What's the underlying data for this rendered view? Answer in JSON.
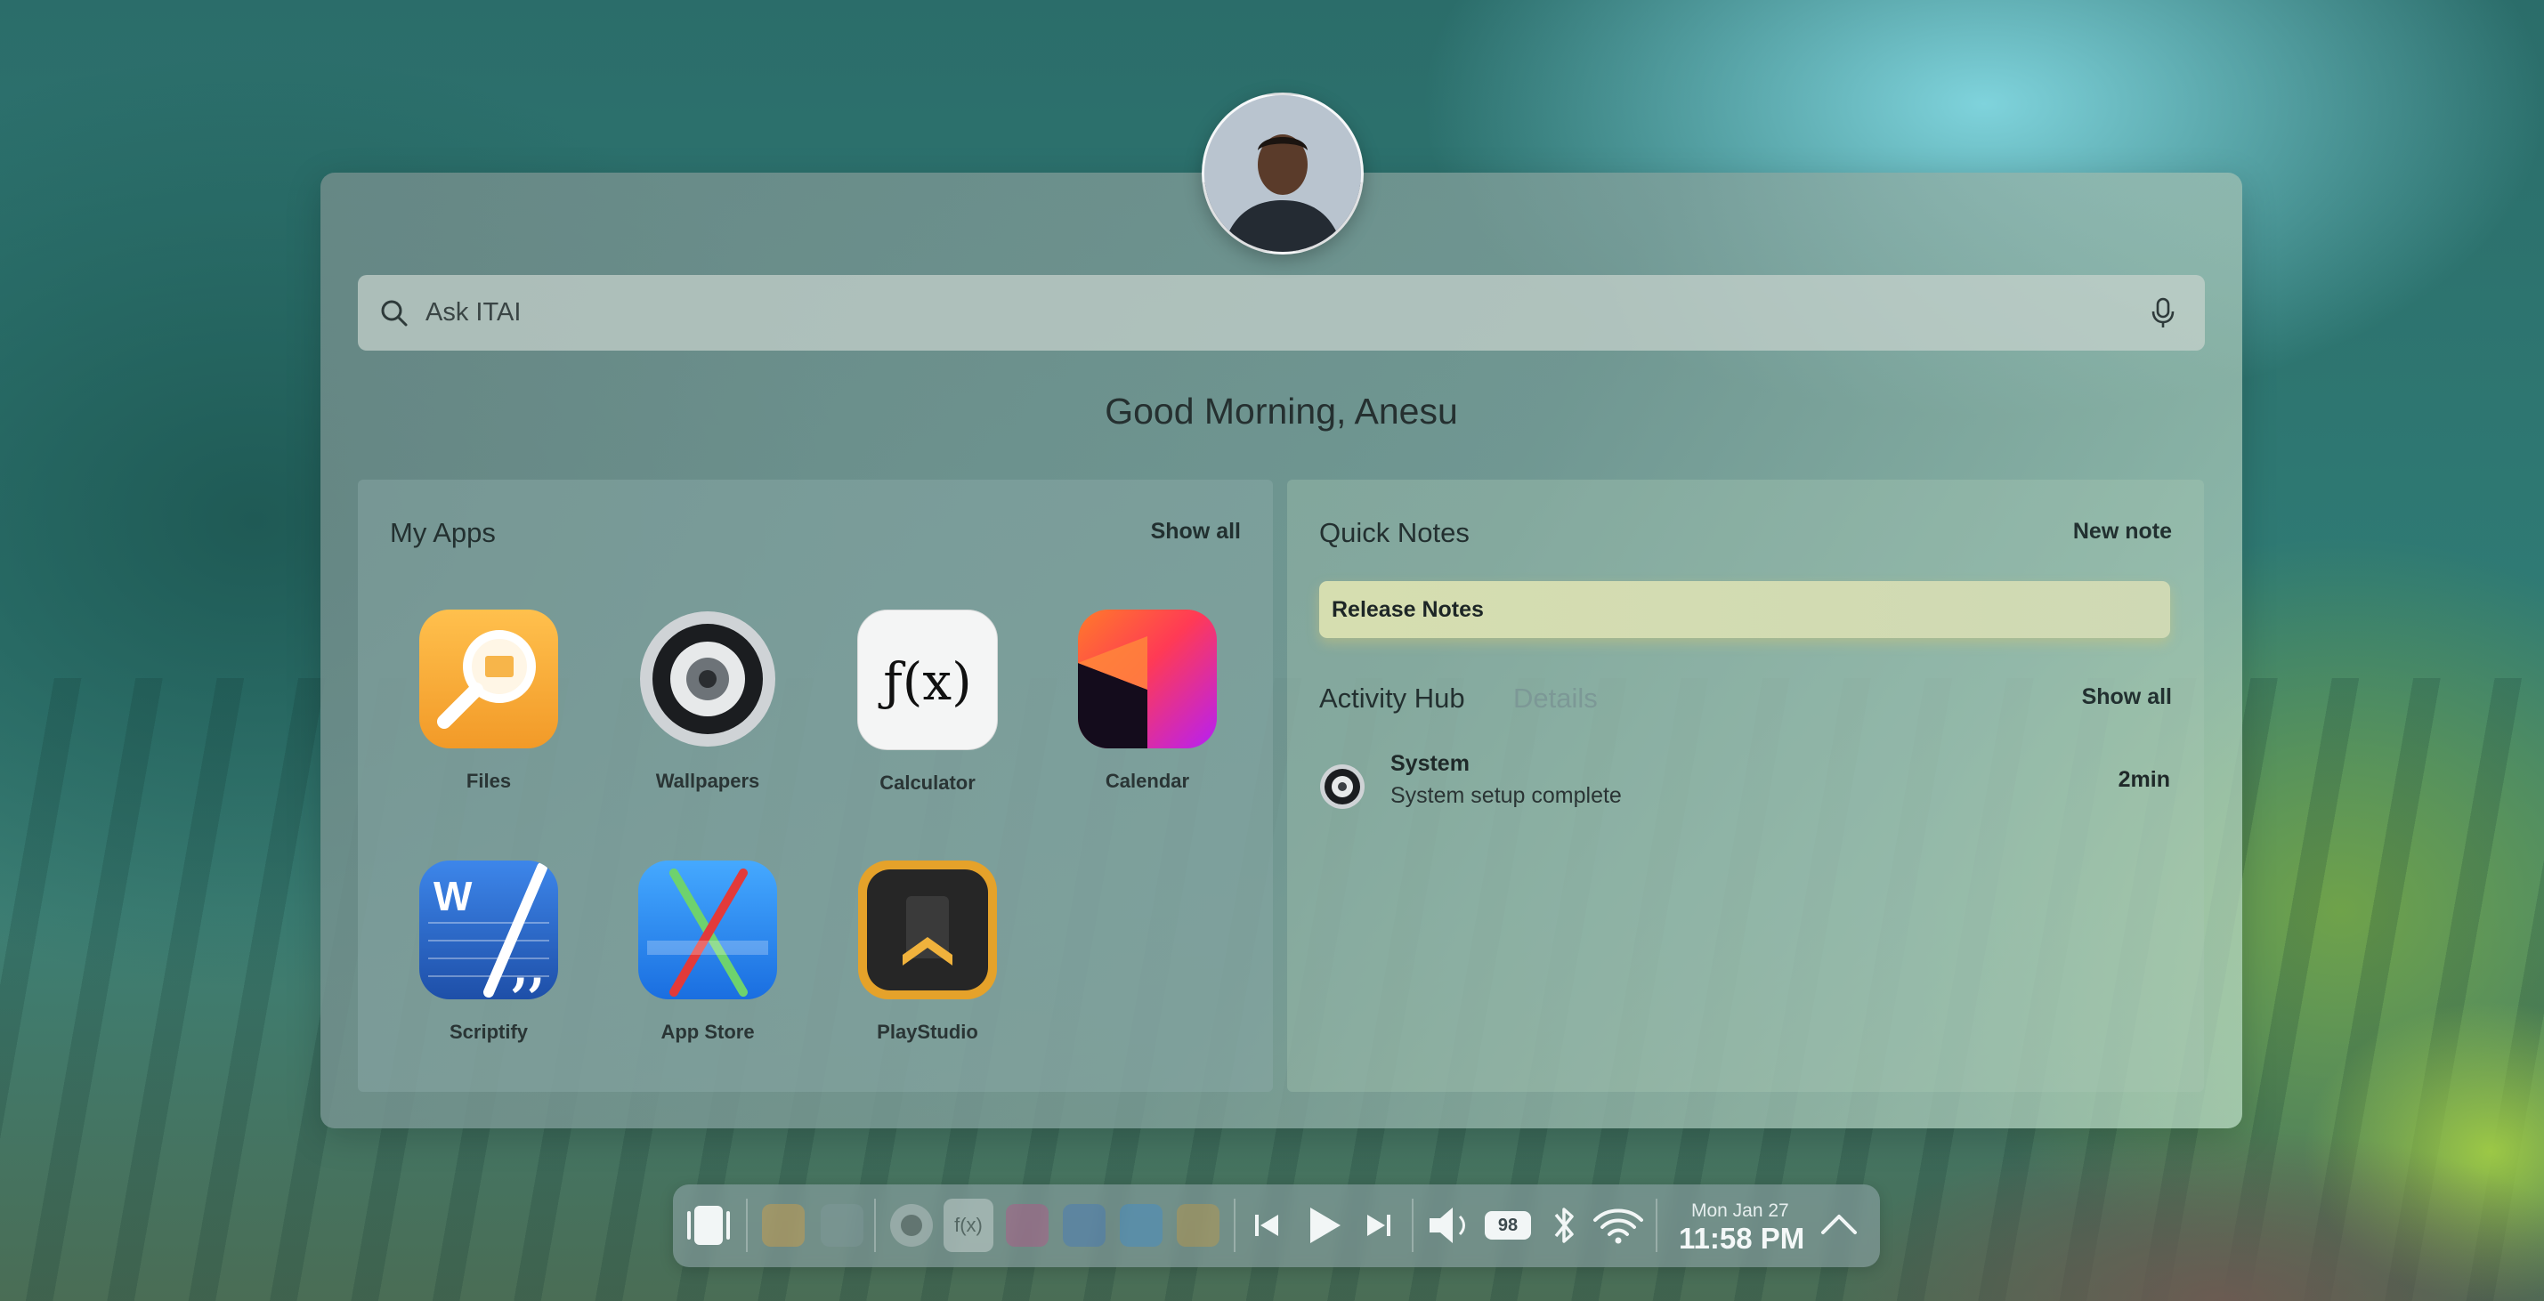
{
  "search": {
    "placeholder": "Ask ITAI"
  },
  "greeting": "Good Morning, Anesu",
  "apps": {
    "title": "My Apps",
    "show_all": "Show all",
    "items": [
      {
        "label": "Files",
        "icon": "files-icon"
      },
      {
        "label": "Wallpapers",
        "icon": "wallpapers-icon"
      },
      {
        "label": "Calculator",
        "icon": "calculator-icon"
      },
      {
        "label": "Calendar",
        "icon": "calendar-icon"
      },
      {
        "label": "Scriptify",
        "icon": "scriptify-icon"
      },
      {
        "label": "App Store",
        "icon": "app-store-icon"
      },
      {
        "label": "PlayStudio",
        "icon": "playstudio-icon"
      }
    ]
  },
  "notes": {
    "title": "Quick Notes",
    "new_note": "New note",
    "items": [
      {
        "title": "Release Notes"
      }
    ]
  },
  "activity": {
    "title": "Activity Hub",
    "details": "Details",
    "show_all": "Show all",
    "items": [
      {
        "name": "System",
        "description": "System setup complete",
        "time": "2min"
      }
    ]
  },
  "dock": {
    "calculator_glyph": "f(x)",
    "battery": "98",
    "date": "Mon Jan 27",
    "time": "11:58 PM"
  },
  "calc_glyph": "ƒ(x)",
  "colors": {
    "files": "#f4a531",
    "calendar_a": "#ff6a2e",
    "calendar_b": "#c61ff0",
    "scriptify": "#2f6fd6",
    "app_store": "#2a8cf0",
    "playstudio": "#e7a12a",
    "note": "#d3dcb0"
  }
}
